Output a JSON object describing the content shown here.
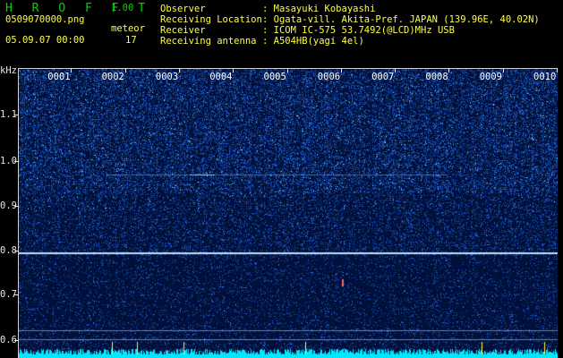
{
  "app": {
    "logo": "H R O F F T",
    "version": "1.00",
    "filename": "0509070000.png",
    "datetime": "05.09.07 00:00",
    "mode_label": "meteor",
    "count": "17"
  },
  "info": {
    "observer_label": "Observer",
    "observer_value": ": Masayuki Kobayashi",
    "location_label": "Receiving Location",
    "location_value": ": Ogata-vill. Akita-Pref. JAPAN (139.96E, 40.02N)",
    "receiver_label": "Receiver",
    "receiver_value": ": ICOM IC-575 53.7492(@LCD)MHz USB",
    "antenna_label": "Receiving antenna",
    "antenna_value": ": A504HB(yagi 4el)"
  },
  "axis": {
    "unit": "kHz",
    "y_ticks": [
      "1.1",
      "1.0",
      "0.9",
      "0.8",
      "0.7",
      "0.6"
    ],
    "time_ticks": [
      "0001",
      "0002",
      "0003",
      "0004",
      "0005",
      "0006",
      "0007",
      "0008",
      "0009",
      "0010"
    ]
  },
  "colors": {
    "background": "#000000",
    "spectrum_base": "#00103a",
    "signal": "#4fa8ff",
    "carrier": "#bfe0ff",
    "noise_floor": "#00e8ff",
    "marker": "#ffff40",
    "header_accent": "#00d200"
  }
}
